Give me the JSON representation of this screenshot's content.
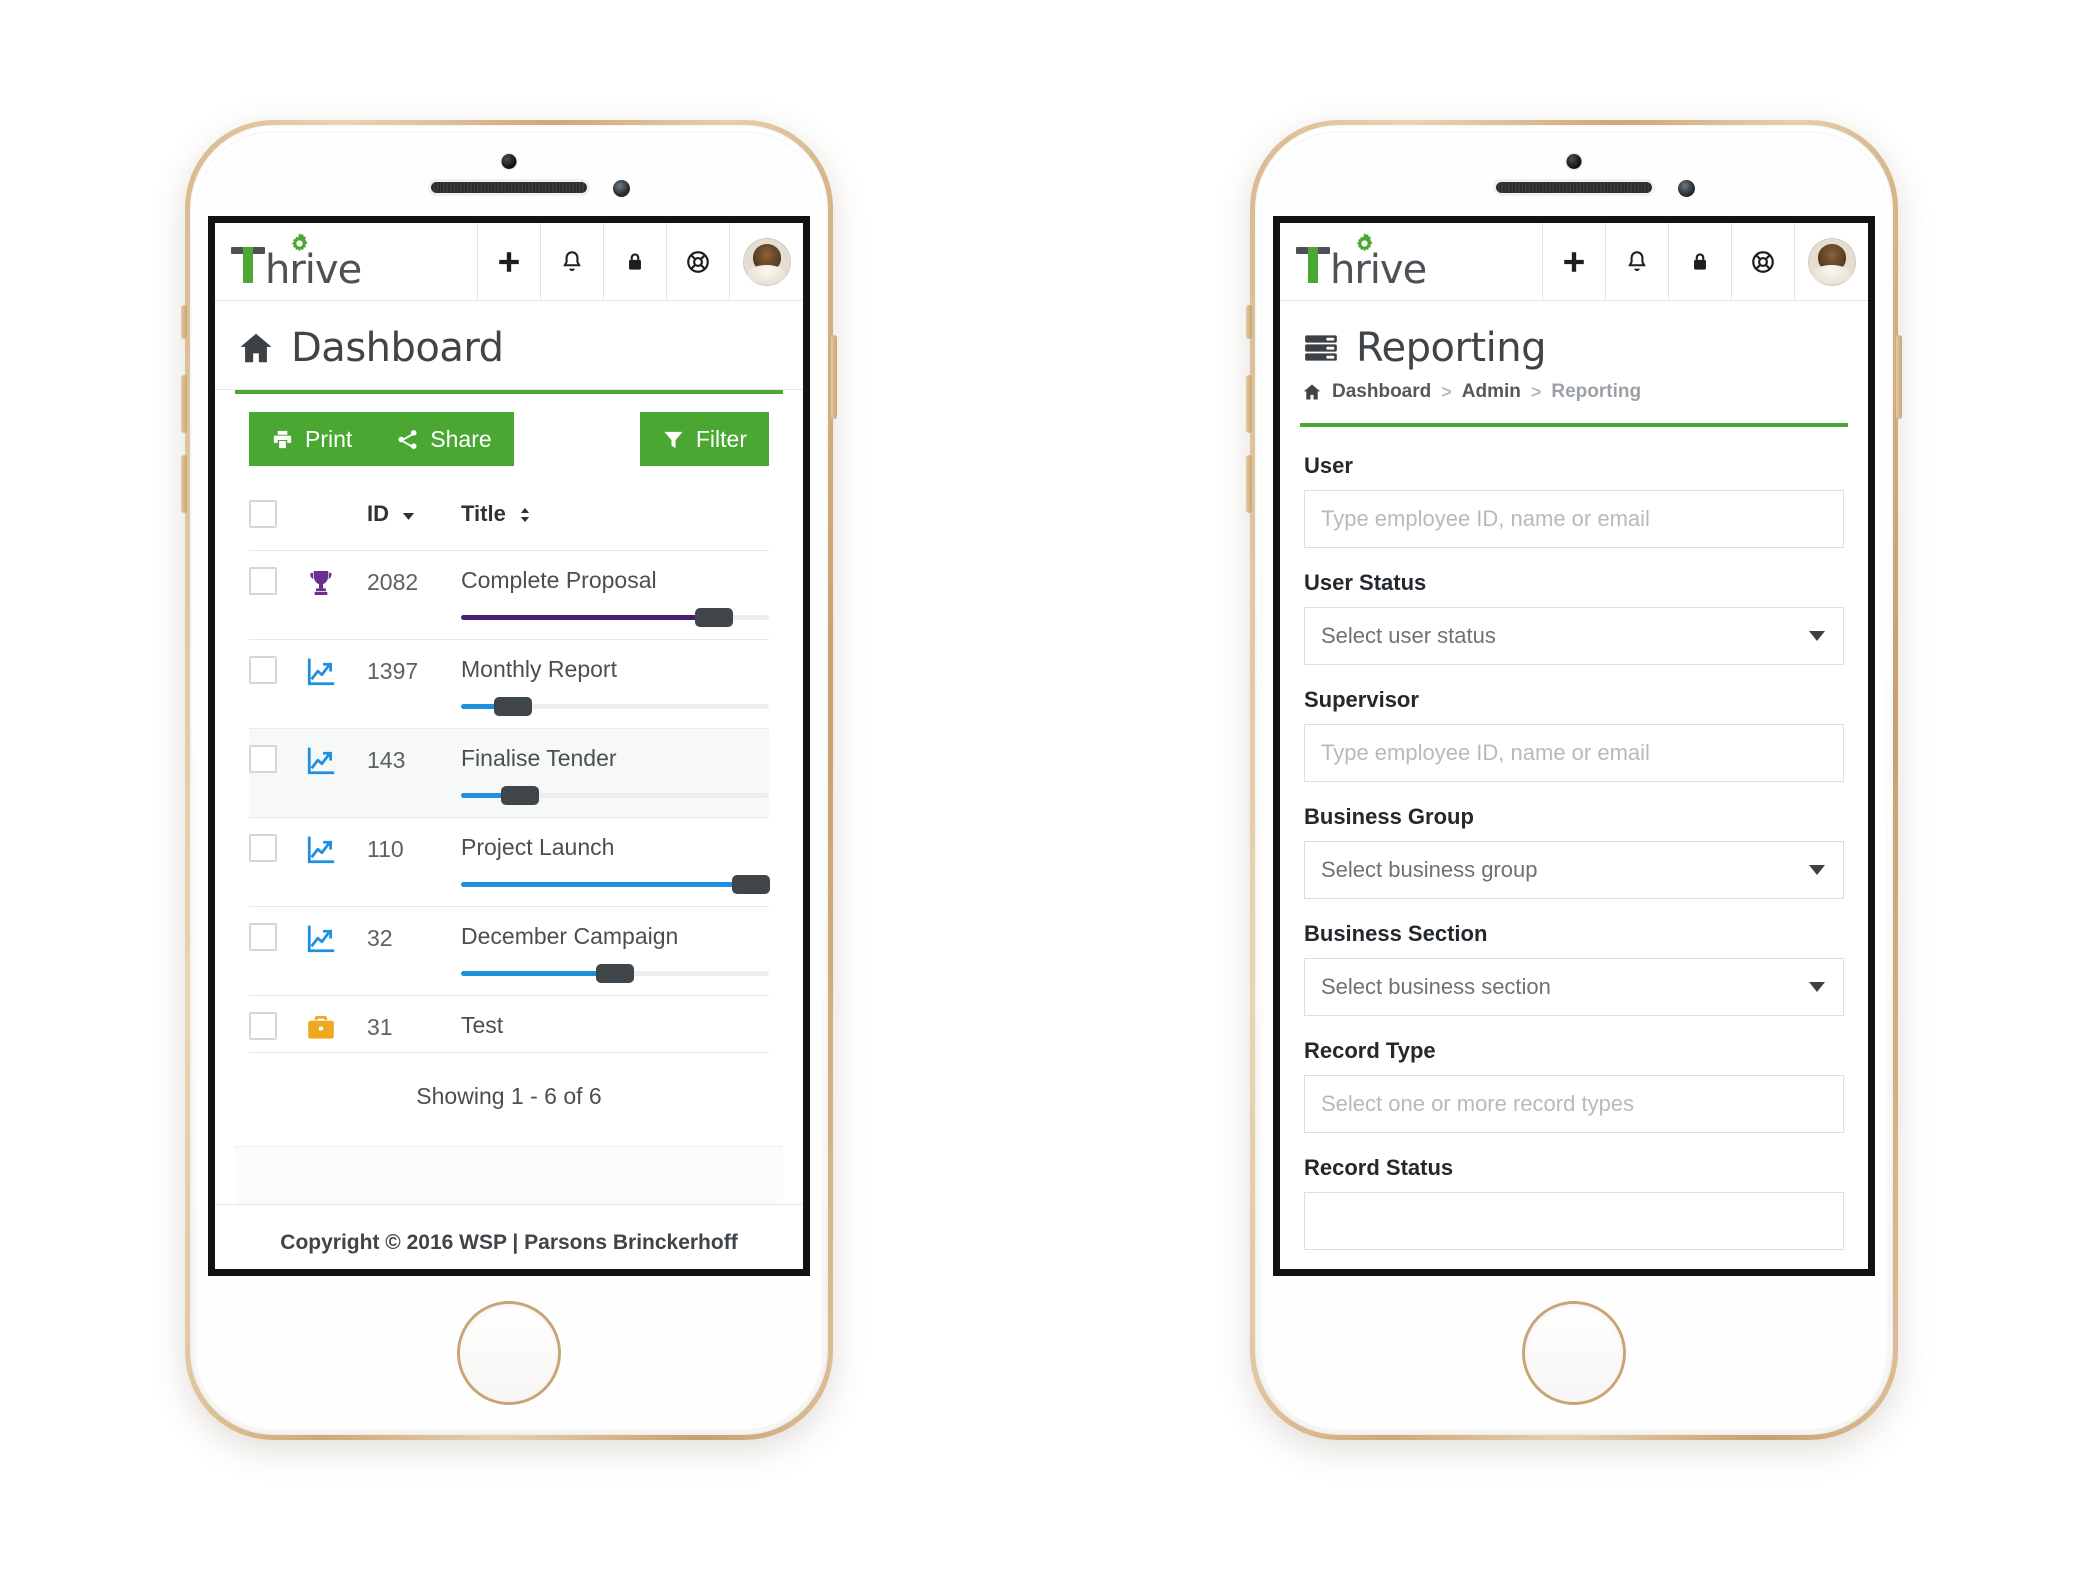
{
  "brand": {
    "name": "Thrive",
    "logo_letter": "T",
    "logo_rest": "hrive",
    "gear_icon": "gear-icon",
    "accent_green": "#4aa832"
  },
  "navbar": {
    "actions": [
      {
        "name": "add-button",
        "icon": "plus-icon"
      },
      {
        "name": "notifications-button",
        "icon": "bell-icon"
      },
      {
        "name": "lock-button",
        "icon": "lock-icon"
      },
      {
        "name": "support-button",
        "icon": "life-ring-icon"
      }
    ],
    "avatar": "user-avatar"
  },
  "left_phone": {
    "page": {
      "icon": "home-icon",
      "title": "Dashboard"
    },
    "toolbar": {
      "print_label": "Print",
      "share_label": "Share",
      "filter_label": "Filter"
    },
    "table": {
      "columns": [
        "",
        "",
        "ID",
        "Title"
      ],
      "id_header": "ID",
      "title_header": "Title",
      "id_sort": "sort-desc-icon",
      "title_sort": "sort-both-icon",
      "rows": [
        {
          "icon": "trophy-icon",
          "icon_color": "#6b2f8f",
          "id": "2082",
          "title": "Complete Proposal",
          "progress": 82,
          "bar_color": "#4a1f73",
          "highlight": false
        },
        {
          "icon": "chart-line-icon",
          "icon_color": "#1f8fe0",
          "id": "1397",
          "title": "Monthly Report",
          "progress": 17,
          "bar_color": "#1f8fe0",
          "highlight": false
        },
        {
          "icon": "chart-line-icon",
          "icon_color": "#1f8fe0",
          "id": "143",
          "title": "Finalise Tender",
          "progress": 19,
          "bar_color": "#1f8fe0",
          "highlight": true
        },
        {
          "icon": "chart-line-icon",
          "icon_color": "#1f8fe0",
          "id": "110",
          "title": "Project Launch",
          "progress": 94,
          "bar_color": "#1f8fe0",
          "highlight": false
        },
        {
          "icon": "chart-line-icon",
          "icon_color": "#1f8fe0",
          "id": "32",
          "title": "December Campaign",
          "progress": 50,
          "bar_color": "#1f8fe0",
          "highlight": false
        },
        {
          "icon": "briefcase-icon",
          "icon_color": "#f0a81e",
          "id": "31",
          "title": "Test",
          "progress": null,
          "bar_color": "",
          "highlight": false
        }
      ],
      "showing": "Showing 1 - 6 of 6"
    },
    "copyright": "Copyright © 2016 WSP | Parsons Brinckerhoff"
  },
  "right_phone": {
    "page": {
      "icon": "server-list-icon",
      "title": "Reporting"
    },
    "breadcrumb": {
      "home_icon": "home-icon",
      "items": [
        "Dashboard",
        "Admin",
        "Reporting"
      ],
      "separator": ">"
    },
    "form": {
      "fields": [
        {
          "label": "User",
          "placeholder": "Type employee ID, name or email",
          "type": "text",
          "name": "user-field"
        },
        {
          "label": "User Status",
          "placeholder": "Select user status",
          "type": "select",
          "name": "user-status-select"
        },
        {
          "label": "Supervisor",
          "placeholder": "Type employee ID, name or email",
          "type": "text",
          "name": "supervisor-field"
        },
        {
          "label": "Business Group",
          "placeholder": "Select business group",
          "type": "select",
          "name": "business-group-select"
        },
        {
          "label": "Business Section",
          "placeholder": "Select business section",
          "type": "select",
          "name": "business-section-select"
        },
        {
          "label": "Record Type",
          "placeholder": "Select one or more record types",
          "type": "text",
          "name": "record-type-field"
        },
        {
          "label": "Record Status",
          "placeholder": "",
          "type": "text",
          "name": "record-status-field"
        }
      ]
    }
  }
}
